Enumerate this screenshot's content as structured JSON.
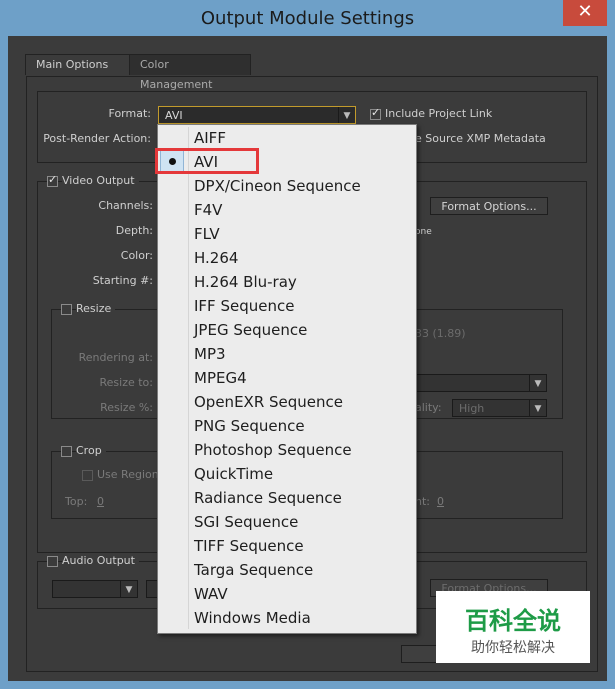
{
  "window": {
    "title": "Output Module Settings",
    "close_glyph": "✕"
  },
  "tabs": [
    {
      "label": "Main Options",
      "active": true
    },
    {
      "label": "Color Management",
      "active": false
    }
  ],
  "main": {
    "format_label": "Format:",
    "format_value": "AVI",
    "include_project_link_label": "Include Project Link",
    "include_project_link_checked": true,
    "post_render_label": "Post-Render Action:",
    "xmp_label": "e Source XMP Metadata",
    "video_output_label": "Video Output",
    "video_output_checked": true,
    "channels_label": "Channels:",
    "depth_label": "Depth:",
    "depth_tail": "one",
    "color_label": "Color:",
    "starting_label": "Starting #:",
    "format_options_label": "Format Options...",
    "resize_label": "Resize",
    "rendering_at_label": "Rendering at:",
    "resize_to_label": "Resize to:",
    "resize_pct_label": "Resize %:",
    "ratio_text": "33 (1.89)",
    "quality_label": "ality:",
    "quality_value": "High",
    "crop_label": "Crop",
    "use_region_label": "Use Region",
    "top_label": "Top:",
    "top_value": "0",
    "right_label": "nt:",
    "right_value": "0",
    "audio_output_label": "Audio Output",
    "audio_format_options_label": "Format Options..."
  },
  "format_menu": {
    "selected": "AVI",
    "items": [
      "AIFF",
      "AVI",
      "DPX/Cineon Sequence",
      "F4V",
      "FLV",
      "H.264",
      "H.264 Blu-ray",
      "IFF Sequence",
      "JPEG Sequence",
      "MP3",
      "MPEG4",
      "OpenEXR Sequence",
      "PNG Sequence",
      "Photoshop Sequence",
      "QuickTime",
      "Radiance Sequence",
      "SGI Sequence",
      "TIFF Sequence",
      "Targa Sequence",
      "WAV",
      "Windows Media"
    ]
  },
  "watermark": {
    "line1": "百科全说",
    "line2": "助你轻松解决"
  },
  "colors": {
    "accent_red": "#e4383a",
    "title_bar": "#6ea0c8",
    "panel_bg": "#3b3b3b"
  }
}
